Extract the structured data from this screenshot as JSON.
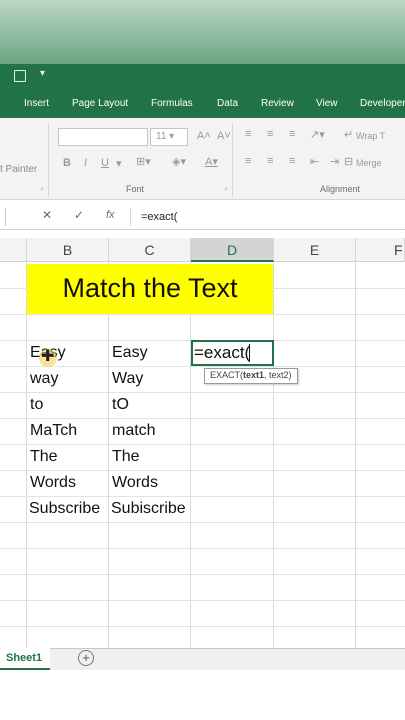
{
  "ribbon_tabs": [
    "Insert",
    "Page Layout",
    "Formulas",
    "Data",
    "Review",
    "View",
    "Developer"
  ],
  "ribbon": {
    "format_painter_label": "t Painter",
    "font_size": "11",
    "font_group_label": "Font",
    "alignment_group_label": "Alignment",
    "wrap_text_label": "Wrap T",
    "merge_label": "Merge"
  },
  "formula_bar": {
    "content": "=exact("
  },
  "columns": [
    "B",
    "C",
    "D",
    "E",
    "F"
  ],
  "title_cell": "Match the Text",
  "column_b": [
    "Easy",
    "way",
    "to",
    "MaTch",
    "The",
    "Words",
    "Subscribe"
  ],
  "column_c": [
    "Easy",
    "Way",
    "tO",
    "match",
    "The",
    "Words",
    "Subiscribe"
  ],
  "active_cell": {
    "column": "D",
    "content": "=exact("
  },
  "tooltip": {
    "function": "EXACT(",
    "arg1": "text1",
    "rest": ", text2)"
  },
  "sheet_tab": "Sheet1",
  "colors": {
    "excel_green": "#217346",
    "title_fill": "#ffff00"
  }
}
